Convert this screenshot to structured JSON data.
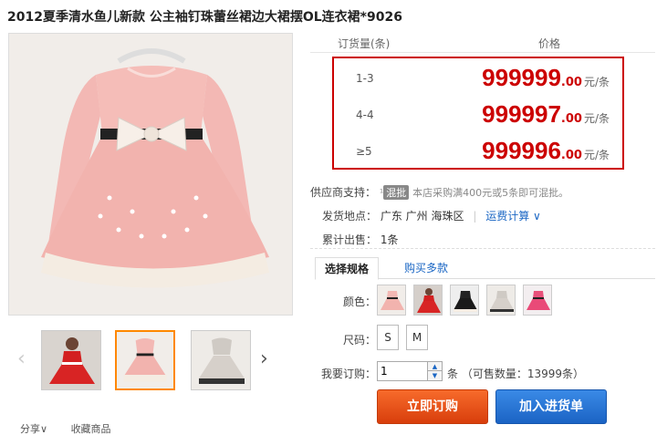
{
  "product": {
    "title": "2012夏季清水鱼儿新款 公主袖钉珠蕾丝裙边大裙摆OL连衣裙*9026"
  },
  "gallery": {
    "prev_arrow": "‹",
    "next_arrow": "›"
  },
  "actions_bottom": {
    "share": "分享∨",
    "favorite": "收藏商品"
  },
  "price_table": {
    "col_qty": "订货量(条)",
    "col_price": "价格",
    "tiers": [
      {
        "qty": "1-3",
        "price_int": "999999",
        "price_dec": ".00",
        "unit": "元/条"
      },
      {
        "qty": "4-4",
        "price_int": "999997",
        "price_dec": ".00",
        "unit": "元/条"
      },
      {
        "qty": "≥5",
        "price_int": "999996",
        "price_dec": ".00",
        "unit": "元/条"
      }
    ],
    "highlight_color": "#cc0000"
  },
  "supplier": {
    "label": "供应商支持：",
    "badge_prefix": "¹",
    "badge": "混批",
    "note": "本店采购满400元或5条即可混批。"
  },
  "shipping": {
    "label": "发货地点：",
    "location": "广东 广州 海珠区",
    "separator": "|",
    "freight_link": "运费计算 ∨"
  },
  "sales": {
    "label": "累计出售：",
    "value": "1条"
  },
  "tabs": {
    "spec": "选择规格",
    "multi": "购买多款"
  },
  "options": {
    "color_label": "颜色：",
    "colors": [
      "pink-dress",
      "red-dress-with-model",
      "black-dress",
      "grey-dress",
      "rose-dress"
    ],
    "size_label": "尺码：",
    "sizes": [
      "S",
      "M"
    ]
  },
  "order": {
    "qty_label": "我要订购：",
    "qty_value": "1",
    "unit_text": "条 （可售数量：13999条）"
  },
  "buttons": {
    "order_now": "立即订购",
    "add_cart": "加入进货单"
  }
}
